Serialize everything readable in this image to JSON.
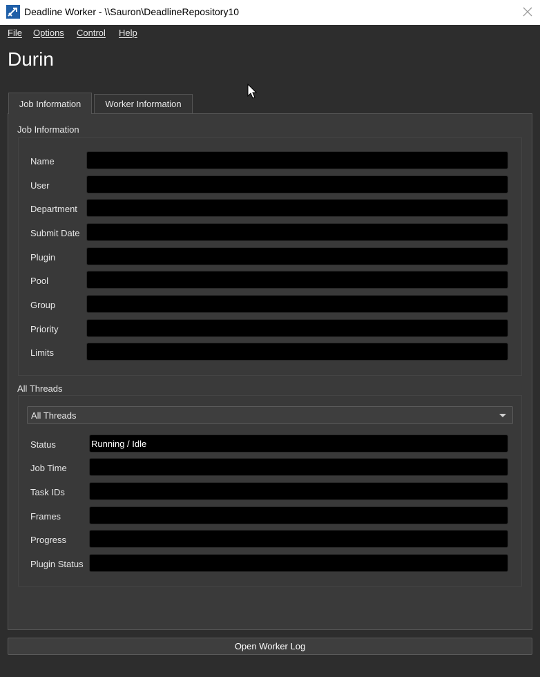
{
  "window": {
    "title": "Deadline Worker  -  \\\\Sauron\\DeadlineRepository10"
  },
  "menu": {
    "items": [
      {
        "label": "File"
      },
      {
        "label": "Options"
      },
      {
        "label": "Control"
      },
      {
        "label": "Help"
      }
    ]
  },
  "page": {
    "title": "Durin"
  },
  "tabs": [
    {
      "label": "Job Information",
      "active": true
    },
    {
      "label": "Worker Information",
      "active": false
    }
  ],
  "job_info": {
    "section_label": "Job Information",
    "fields": [
      {
        "label": "Name",
        "value": ""
      },
      {
        "label": "User",
        "value": ""
      },
      {
        "label": "Department",
        "value": ""
      },
      {
        "label": "Submit Date",
        "value": ""
      },
      {
        "label": "Plugin",
        "value": ""
      },
      {
        "label": "Pool",
        "value": ""
      },
      {
        "label": "Group",
        "value": ""
      },
      {
        "label": "Priority",
        "value": ""
      },
      {
        "label": "Limits",
        "value": ""
      }
    ]
  },
  "threads": {
    "section_label": "All Threads",
    "selected": "All Threads",
    "fields": [
      {
        "label": "Status",
        "value": "Running / Idle"
      },
      {
        "label": "Job Time",
        "value": ""
      },
      {
        "label": "Task IDs",
        "value": ""
      },
      {
        "label": "Frames",
        "value": ""
      },
      {
        "label": "Progress",
        "value": ""
      },
      {
        "label": "Plugin Status",
        "value": ""
      }
    ]
  },
  "footer": {
    "open_log_label": "Open Worker Log"
  },
  "colors": {
    "background": "#2d2d2d",
    "panel": "#3a3a3a",
    "field": "#000000",
    "titlebar": "#ffffff",
    "app_icon": "#1f5fa8"
  }
}
